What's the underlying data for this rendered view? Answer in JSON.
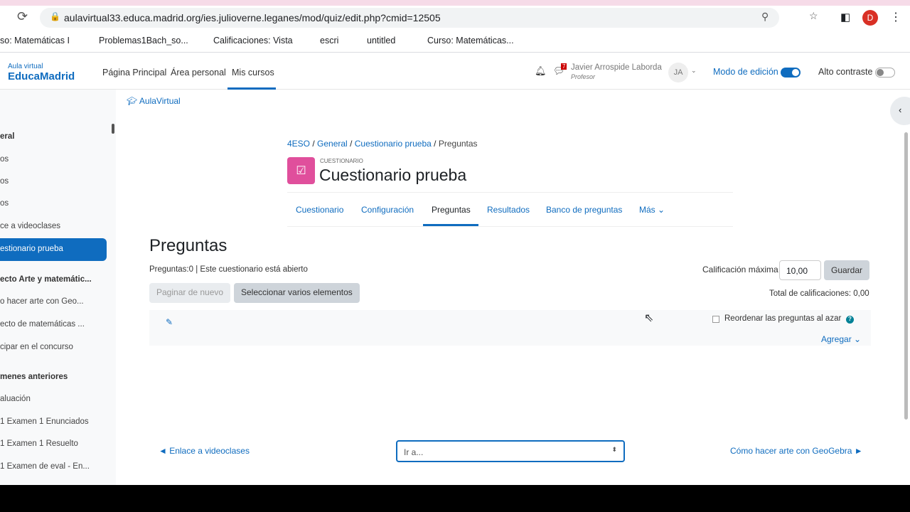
{
  "browser": {
    "url": "aulavirtual33.educa.madrid.org/ies.julioverne.leganes/mod/quiz/edit.php?cmid=12505",
    "avatar": "D",
    "bookmarks": [
      "so: Matemáticas I",
      "Problemas1Bach_so...",
      "Calificaciones: Vista",
      "escri",
      "untitled",
      "Curso: Matemáticas..."
    ]
  },
  "nav": {
    "logo_top": "Aula virtual",
    "logo_main": "EducaMadrid",
    "links": [
      "Página Principal",
      "Área personal",
      "Mis cursos"
    ],
    "notif_count": "7",
    "user_name": "Javier Arrospide Laborda",
    "user_role": "Profesor",
    "initials": "JA",
    "edit_mode": "Modo de edición",
    "contrast": "Alto contraste"
  },
  "sidebar": {
    "items": [
      "eral",
      "os",
      "os",
      "os",
      "ce a videoclases",
      "estionario prueba",
      "ecto Arte y matemátic...",
      "o hacer arte con Geo...",
      "ecto de matemáticas ...",
      "cipar en el concurso",
      "menes anteriores",
      "aluación",
      "1 Examen 1 Enunciados",
      "1 Examen 1 Resuelto",
      "1 Examen de eval - En..."
    ]
  },
  "main": {
    "aulavirtual": "AulaVirtual",
    "breadcrumb": [
      "4ESO",
      "General",
      "Cuestionario prueba",
      "Preguntas"
    ],
    "kicker": "CUESTIONARIO",
    "title": "Cuestionario prueba",
    "tabs": [
      "Cuestionario",
      "Configuración",
      "Preguntas",
      "Resultados",
      "Banco de preguntas",
      "Más"
    ],
    "heading": "Preguntas",
    "info": "Preguntas:0 | Este cuestionario está abierto",
    "max_label": "Calificación máxima",
    "max_value": "10,00",
    "save": "Guardar",
    "total": "Total de calificaciones: 0,00",
    "repaginate": "Paginar de nuevo",
    "select_multi": "Seleccionar varios elementos",
    "shuffle": "Reordenar las preguntas al azar",
    "add": "Agregar",
    "prev": "◄ Enlace a videoclases",
    "jump_placeholder": "Ir a...",
    "next": "Cómo hacer arte con GeoGebra ►"
  }
}
